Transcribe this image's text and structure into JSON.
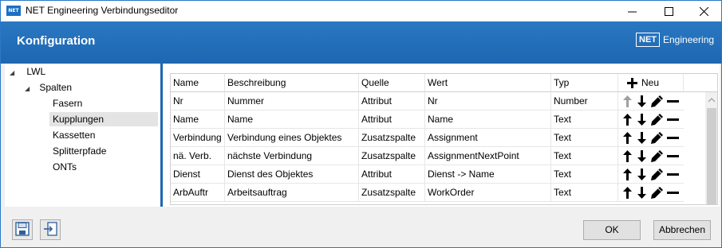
{
  "window": {
    "title": "NET Engineering Verbindungseditor",
    "icon_text": "NET",
    "controls": [
      "minimize-icon",
      "maximize-icon",
      "close-icon"
    ]
  },
  "header": {
    "title": "Konfiguration",
    "logo_box": "NET",
    "logo_text": "Engineering",
    "color": "#1e67b2"
  },
  "tree": {
    "root": "LWL",
    "child": "Spalten",
    "items": [
      "Fasern",
      "Kupplungen",
      "Kassetten",
      "Splitterpfade",
      "ONTs"
    ],
    "selected": "Kupplungen"
  },
  "grid": {
    "headers": {
      "name": "Name",
      "beschreibung": "Beschreibung",
      "quelle": "Quelle",
      "wert": "Wert",
      "typ": "Typ",
      "neu": "Neu"
    },
    "rows": [
      {
        "name": "Nr",
        "beschreibung": "Nummer",
        "quelle": "Attribut",
        "wert": "Nr",
        "typ": "Number",
        "up_enabled": false
      },
      {
        "name": "Name",
        "beschreibung": "Name",
        "quelle": "Attribut",
        "wert": "Name",
        "typ": "Text",
        "up_enabled": true
      },
      {
        "name": "Verbindung",
        "beschreibung": "Verbindung eines Objektes",
        "quelle": "Zusatzspalte",
        "wert": "Assignment",
        "typ": "Text",
        "up_enabled": true
      },
      {
        "name": "nä. Verb.",
        "beschreibung": "nächste Verbindung",
        "quelle": "Zusatzspalte",
        "wert": "AssignmentNextPoint",
        "typ": "Text",
        "up_enabled": true
      },
      {
        "name": "Dienst",
        "beschreibung": "Dienst des Objektes",
        "quelle": "Attribut",
        "wert": "Dienst -> Name",
        "typ": "Text",
        "up_enabled": true
      },
      {
        "name": "ArbAuftr",
        "beschreibung": "Arbeitsauftrag",
        "quelle": "Zusatzspalte",
        "wert": "WorkOrder",
        "typ": "Text",
        "up_enabled": true
      }
    ],
    "row_icons": [
      "arrow-up-icon",
      "arrow-down-icon",
      "pencil-icon",
      "minus-icon"
    ]
  },
  "footer": {
    "save_icon": "save-icon",
    "import_icon": "import-icon",
    "ok_label": "OK",
    "cancel_label": "Abbrechen"
  }
}
